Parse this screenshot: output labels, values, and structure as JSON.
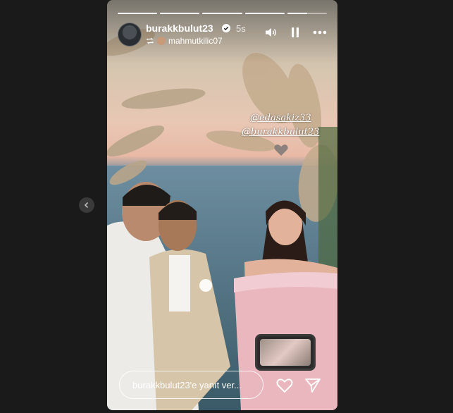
{
  "story": {
    "username": "burakkbulut23",
    "time": "5s",
    "reposted_from": "mahmutkilic07",
    "progress": [
      1,
      1,
      1,
      1,
      0.5
    ],
    "tags": [
      "@edasakiz33",
      "@burakkbulut23"
    ]
  },
  "reply": {
    "placeholder": "burakkbulut23'e yanıt ver..."
  },
  "icons": [
    "chevron-left-icon",
    "verified-icon",
    "repost-icon",
    "volume-icon",
    "pause-icon",
    "more-icon",
    "heart-icon",
    "send-icon"
  ],
  "colors": {
    "background": "#1a1a1a",
    "text": "#ffffff"
  }
}
